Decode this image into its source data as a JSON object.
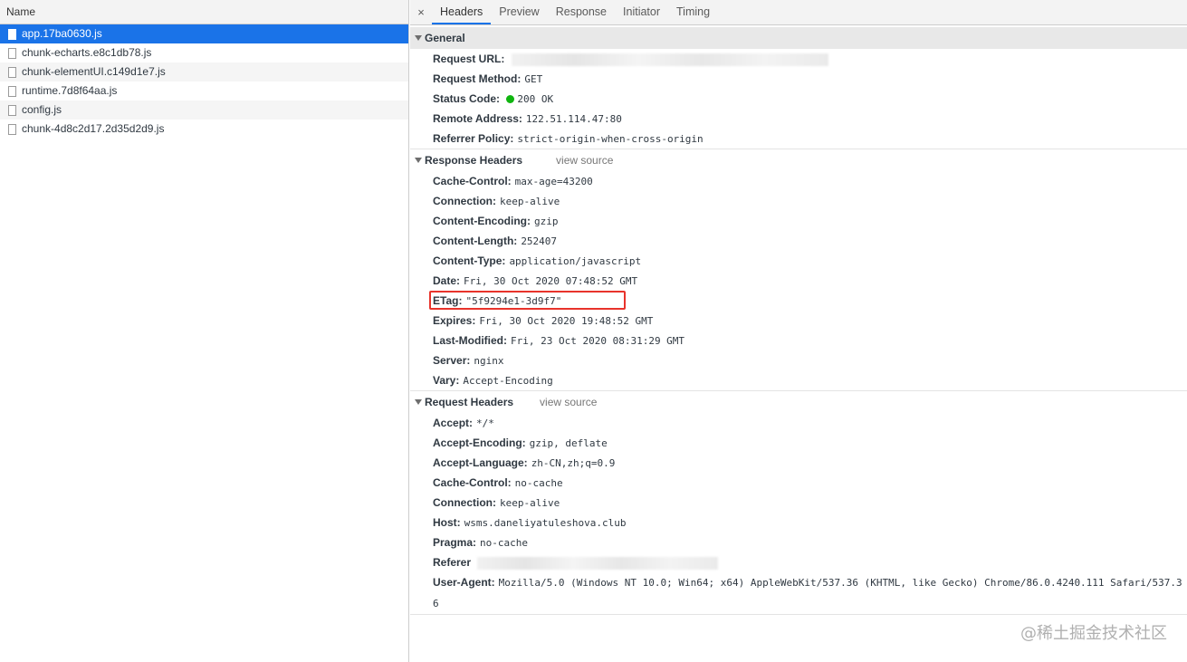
{
  "left": {
    "header": "Name",
    "files": [
      "app.17ba0630.js",
      "chunk-echarts.e8c1db78.js",
      "chunk-elementUI.c149d1e7.js",
      "runtime.7d8f64aa.js",
      "config.js",
      "chunk-4d8c2d17.2d35d2d9.js"
    ],
    "selected_index": 0
  },
  "tabs": {
    "close": "×",
    "items": [
      "Headers",
      "Preview",
      "Response",
      "Initiator",
      "Timing"
    ],
    "active": "Headers"
  },
  "general": {
    "title": "General",
    "request_url_key": "Request URL:",
    "request_method_key": "Request Method:",
    "request_method": "GET",
    "status_code_key": "Status Code:",
    "status_code": "200 OK",
    "remote_address_key": "Remote Address:",
    "remote_address": "122.51.114.47:80",
    "referrer_policy_key": "Referrer Policy:",
    "referrer_policy": "strict-origin-when-cross-origin"
  },
  "response_headers": {
    "title": "Response Headers",
    "view_source": "view source",
    "rows": [
      {
        "key": "Cache-Control:",
        "value": "max-age=43200"
      },
      {
        "key": "Connection:",
        "value": "keep-alive"
      },
      {
        "key": "Content-Encoding:",
        "value": "gzip"
      },
      {
        "key": "Content-Length:",
        "value": "252407"
      },
      {
        "key": "Content-Type:",
        "value": "application/javascript"
      },
      {
        "key": "Date:",
        "value": "Fri, 30 Oct 2020 07:48:52 GMT"
      },
      {
        "key": "ETag:",
        "value": "\"5f9294e1-3d9f7\""
      },
      {
        "key": "Expires:",
        "value": "Fri, 30 Oct 2020 19:48:52 GMT"
      },
      {
        "key": "Last-Modified:",
        "value": "Fri, 23 Oct 2020 08:31:29 GMT"
      },
      {
        "key": "Server:",
        "value": "nginx"
      },
      {
        "key": "Vary:",
        "value": "Accept-Encoding"
      }
    ]
  },
  "request_headers": {
    "title": "Request Headers",
    "view_source": "view source",
    "rows": [
      {
        "key": "Accept:",
        "value": "*/*"
      },
      {
        "key": "Accept-Encoding:",
        "value": "gzip, deflate"
      },
      {
        "key": "Accept-Language:",
        "value": "zh-CN,zh;q=0.9"
      },
      {
        "key": "Cache-Control:",
        "value": "no-cache"
      },
      {
        "key": "Connection:",
        "value": "keep-alive"
      },
      {
        "key": "Host:",
        "value": "wsms.daneliyatuleshova.club"
      },
      {
        "key": "Pragma:",
        "value": "no-cache"
      }
    ],
    "referer_key": "Referer",
    "user_agent_key": "User-Agent:",
    "user_agent": "Mozilla/5.0 (Windows NT 10.0; Win64; x64) AppleWebKit/537.36 (KHTML, like Gecko) Chrome/86.0.4240.111 Safari/537.36"
  },
  "watermark": "@稀土掘金技术社区",
  "colors": {
    "selection": "#1a73e8",
    "status_ok": "#0fb50f",
    "highlight": "#e8332b"
  }
}
